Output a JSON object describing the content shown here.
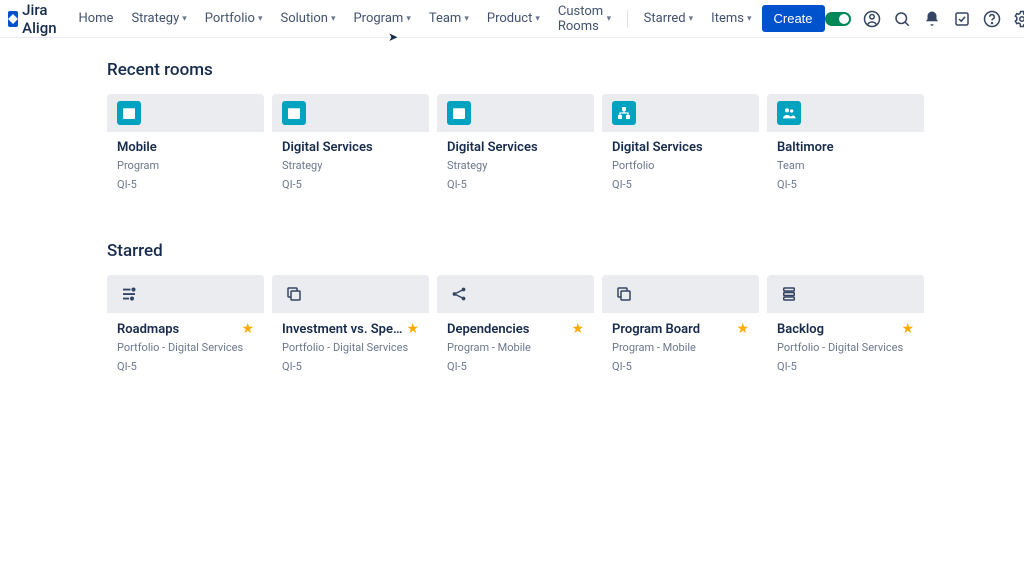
{
  "brand": "Jira Align",
  "nav": {
    "home": "Home",
    "strategy": "Strategy",
    "portfolio": "Portfolio",
    "solution": "Solution",
    "program": "Program",
    "team": "Team",
    "product": "Product",
    "custom_rooms": "Custom Rooms",
    "starred": "Starred",
    "items": "Items",
    "create": "Create"
  },
  "sections": {
    "recent_title": "Recent rooms",
    "starred_title": "Starred"
  },
  "recent": [
    {
      "title": "Mobile",
      "sub": "Program",
      "meta": "QI-5",
      "icon": "calendar"
    },
    {
      "title": "Digital Services",
      "sub": "Strategy",
      "meta": "QI-5",
      "icon": "calendar"
    },
    {
      "title": "Digital Services",
      "sub": "Strategy",
      "meta": "QI-5",
      "icon": "calendar"
    },
    {
      "title": "Digital Services",
      "sub": "Portfolio",
      "meta": "QI-5",
      "icon": "hierarchy"
    },
    {
      "title": "Baltimore",
      "sub": "Team",
      "meta": "QI-5",
      "icon": "people"
    }
  ],
  "starred": [
    {
      "title": "Roadmaps",
      "sub": "Portfolio - Digital Services",
      "meta": "QI-5",
      "icon": "roadmap"
    },
    {
      "title": "Investment vs. Spend",
      "sub": "Portfolio - Digital Services",
      "meta": "QI-5",
      "icon": "copy"
    },
    {
      "title": "Dependencies",
      "sub": "Program - Mobile",
      "meta": "QI-5",
      "icon": "share"
    },
    {
      "title": "Program Board",
      "sub": "Program - Mobile",
      "meta": "QI-5",
      "icon": "copy"
    },
    {
      "title": "Backlog",
      "sub": "Portfolio - Digital Services",
      "meta": "QI-5",
      "icon": "backlog"
    }
  ]
}
